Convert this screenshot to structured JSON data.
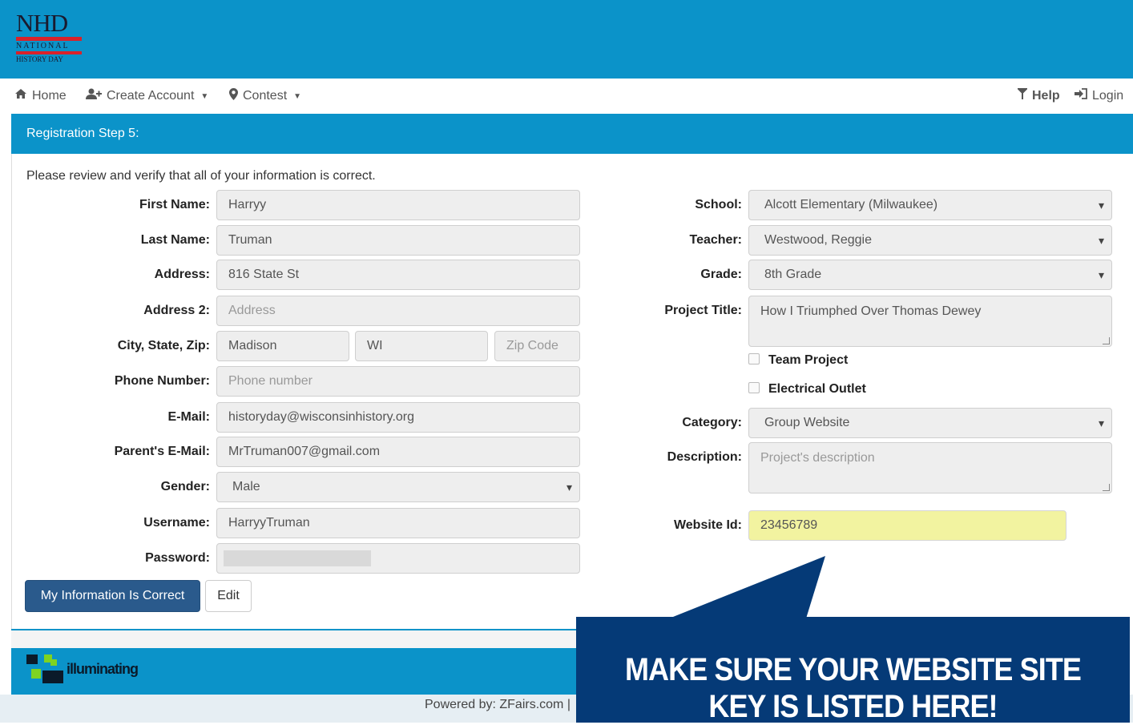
{
  "logo": {
    "line1": "NHD",
    "line2": "NATIONAL",
    "line3": "HISTORY DAY"
  },
  "nav": {
    "home": "Home",
    "create_account": "Create Account",
    "contest": "Contest",
    "help": "Help",
    "login": "Login"
  },
  "step_title": "Registration Step 5:",
  "intro": "Please review and verify that all of your information is correct.",
  "left": {
    "first_name": {
      "label": "First Name:",
      "value": "Harryy"
    },
    "last_name": {
      "label": "Last Name:",
      "value": "Truman"
    },
    "address": {
      "label": "Address:",
      "value": "816 State St"
    },
    "address2": {
      "label": "Address 2:",
      "placeholder": "Address"
    },
    "city_state_zip": {
      "label": "City, State, Zip:",
      "city": "Madison",
      "state": "WI",
      "zip_placeholder": "Zip Code"
    },
    "phone": {
      "label": "Phone Number:",
      "placeholder": "Phone number"
    },
    "email": {
      "label": "E-Mail:",
      "value": "historyday@wisconsinhistory.org"
    },
    "parent_email": {
      "label": "Parent's E-Mail:",
      "value": "MrTruman007@gmail.com"
    },
    "gender": {
      "label": "Gender:",
      "value": "Male"
    },
    "username": {
      "label": "Username:",
      "value": "HarryyTruman"
    },
    "password": {
      "label": "Password:"
    }
  },
  "right": {
    "school": {
      "label": "School:",
      "value": "Alcott Elementary (Milwaukee)"
    },
    "teacher": {
      "label": "Teacher:",
      "value": "Westwood, Reggie"
    },
    "grade": {
      "label": "Grade:",
      "value": "8th Grade"
    },
    "project_title": {
      "label": "Project Title:",
      "value": "How I Triumphed Over Thomas Dewey"
    },
    "team_project": "Team Project",
    "electrical_outlet": "Electrical Outlet",
    "category": {
      "label": "Category:",
      "value": "Group Website"
    },
    "description": {
      "label": "Description:",
      "placeholder": "Project's description"
    },
    "website_id": {
      "label": "Website Id:",
      "value": "23456789"
    }
  },
  "buttons": {
    "confirm": "My Information Is Correct",
    "edit": "Edit"
  },
  "footer": {
    "brand": "illuminating",
    "powered": "Powered by: ZFairs.com |"
  },
  "callout": {
    "line1": "MAKE SURE YOUR WEBSITE SITE",
    "line2": "KEY IS LISTED HERE!"
  },
  "colors": {
    "brand_blue": "#0b93c9",
    "button_blue": "#2a5a8c",
    "callout_navy": "#053a77",
    "highlight": "#f2f3a0"
  }
}
